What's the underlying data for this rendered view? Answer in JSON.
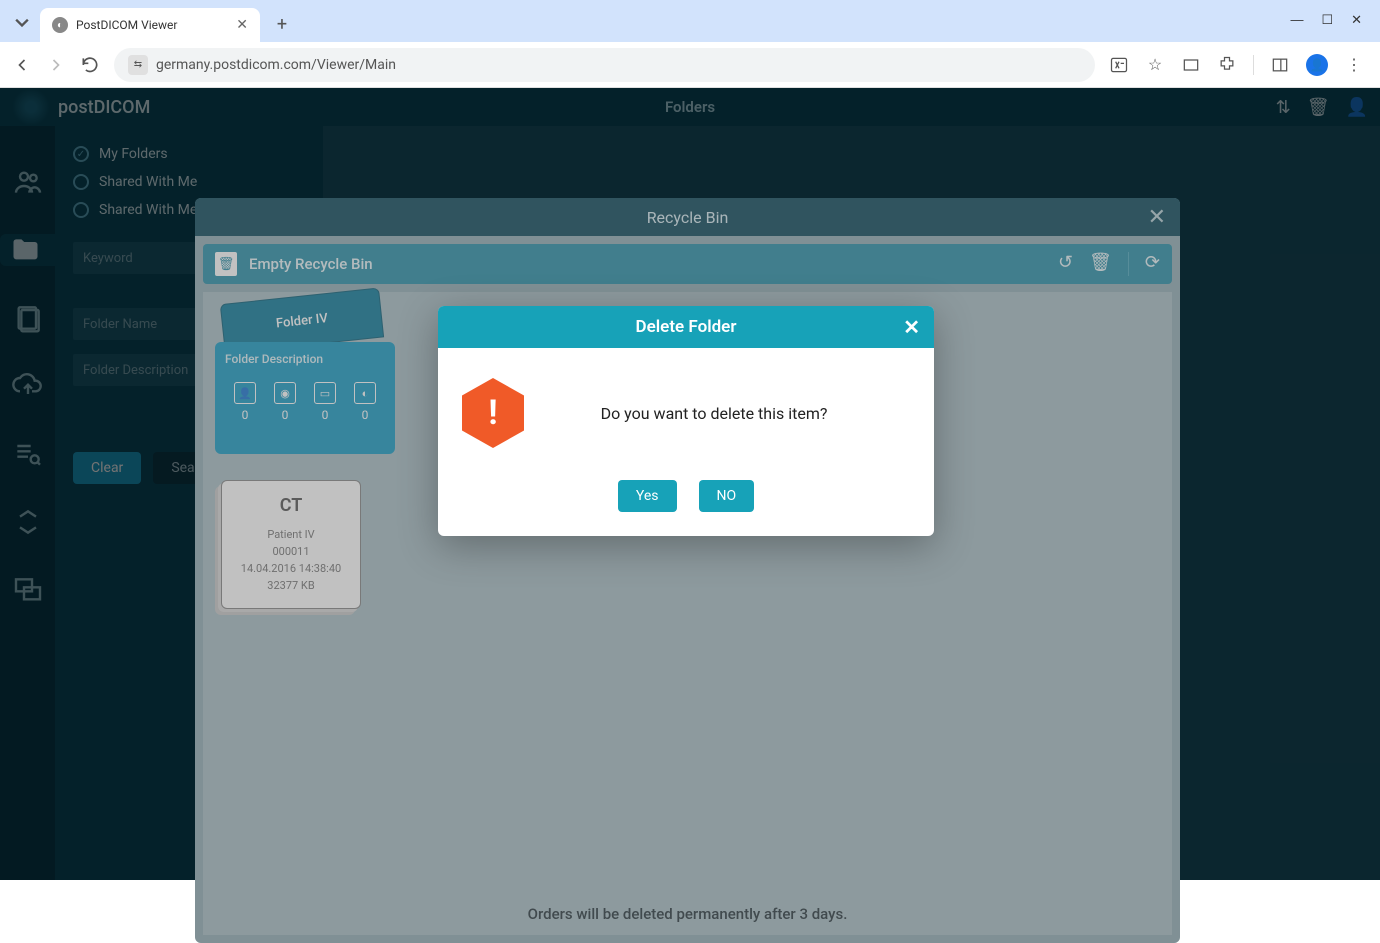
{
  "browser": {
    "tab_title": "PostDICOM Viewer",
    "url": "germany.postdicom.com/Viewer/Main"
  },
  "app": {
    "logo": "postDICOM",
    "header_title": "Folders"
  },
  "sidebar": {
    "radios": {
      "my_folders": "My Folders",
      "shared_with_me": "Shared With Me",
      "shared_with_others": "Shared With Me"
    },
    "keyword_placeholder": "Keyword",
    "folder_name_placeholder": "Folder Name",
    "folder_desc_placeholder": "Folder Description",
    "clear": "Clear",
    "search": "Search"
  },
  "recycle": {
    "title": "Recycle Bin",
    "empty_label": "Empty Recycle Bin",
    "footer": "Orders will be deleted permanently after 3 days.",
    "folder": {
      "name": "Folder IV",
      "desc": "Folder Description",
      "counts": [
        "0",
        "0",
        "0",
        "0"
      ]
    },
    "study": {
      "modality": "CT",
      "patient": "Patient IV",
      "id": "000011",
      "datetime": "14.04.2016 14:38:40",
      "size": "32377 KB"
    }
  },
  "confirm": {
    "title": "Delete Folder",
    "message": "Do you want to delete this item?",
    "yes": "Yes",
    "no": "NO"
  }
}
